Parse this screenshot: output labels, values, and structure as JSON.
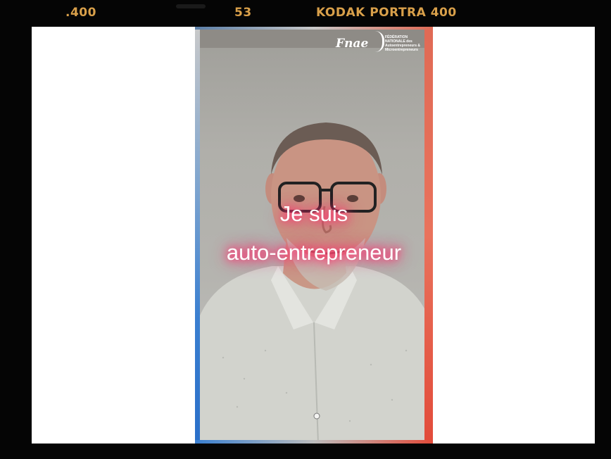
{
  "film": {
    "left_label": ".400",
    "frame_number": "53",
    "stock_label": "KODAK PORTRA 400",
    "text_color": "#d9a04a"
  },
  "logo": {
    "script_name": "Fnae",
    "subtitle": "FÉDÉRATION NATIONALE des Autoentrepreneurs & Microentrepreneurs"
  },
  "caption": {
    "line1": "Je suis",
    "line2": "auto-entrepreneur",
    "glow_color": "#ff2f6e"
  },
  "frame_colors": {
    "left_edge": "#2a6fc9",
    "right_edge": "#e24b3a"
  }
}
